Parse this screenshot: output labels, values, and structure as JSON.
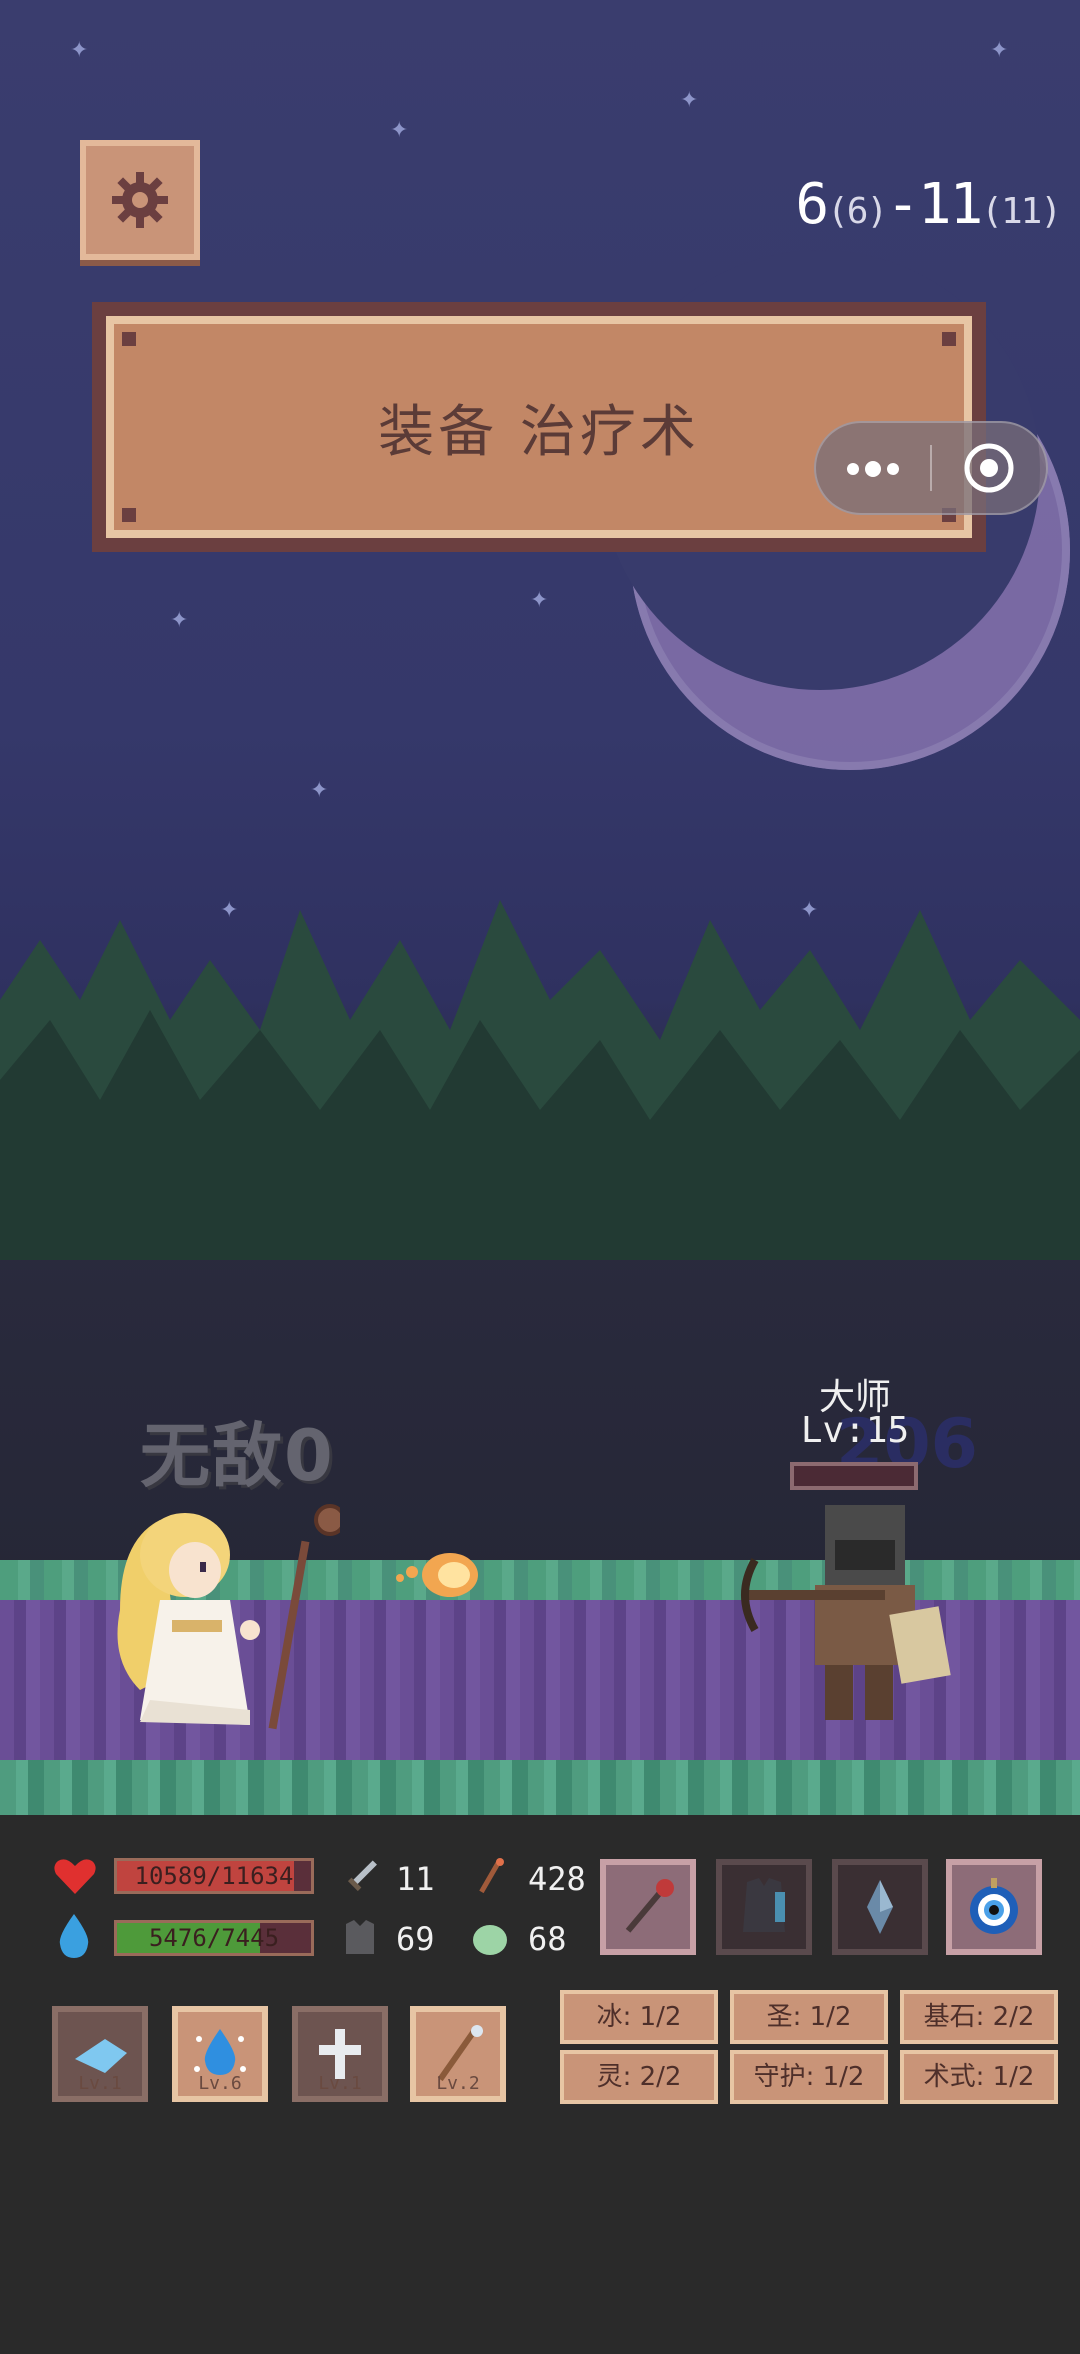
{
  "hud_top": {
    "level_main": "6",
    "level_main_sub": "(6)",
    "level_dash": "-",
    "level_sub": "11",
    "level_sub_sub": "(11)"
  },
  "banner": {
    "text": "装备 治疗术"
  },
  "battle": {
    "invincible_text": "无敌0",
    "enemy_name": "大师",
    "enemy_level": "Lv:15",
    "damage_number": "206"
  },
  "player": {
    "hp_text": "10589/11634",
    "hp_fraction": 0.91,
    "mp_text": "5476/7445",
    "mp_fraction": 0.735,
    "attack": "11",
    "magic_attack": "428",
    "defense": "69",
    "magic_defense": "68"
  },
  "equipment": [
    {
      "name": "staff-icon",
      "style": "light"
    },
    {
      "name": "armor-icon",
      "style": "dark"
    },
    {
      "name": "crystal-icon",
      "style": "dark"
    },
    {
      "name": "amulet-icon",
      "style": "light"
    }
  ],
  "skills": [
    {
      "name": "ice-shard-skill",
      "level": "Lv.1",
      "style": "dim"
    },
    {
      "name": "water-drop-skill",
      "level": "Lv.6",
      "style": "light"
    },
    {
      "name": "holy-cross-skill",
      "level": "Lv.1",
      "style": "dim"
    },
    {
      "name": "staff-skill",
      "level": "Lv.2",
      "style": "light"
    }
  ],
  "tags": [
    [
      "冰: 1/2",
      "圣: 1/2",
      "基石: 2/2"
    ],
    [
      "灵: 2/2",
      "守护: 1/2",
      "术式: 1/2"
    ]
  ],
  "colors": {
    "hp": "#c0443f",
    "mp": "#4e9a3a",
    "panel": "#c99478"
  }
}
